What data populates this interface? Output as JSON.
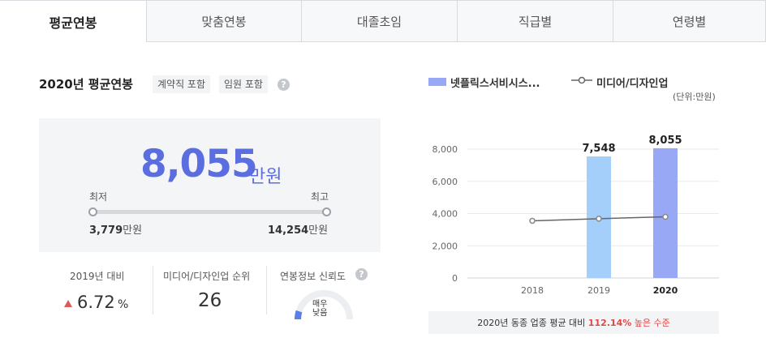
{
  "tabs": [
    {
      "label": "평균연봉",
      "active": true
    },
    {
      "label": "맞춤연봉",
      "active": false
    },
    {
      "label": "대졸초임",
      "active": false
    },
    {
      "label": "직급별",
      "active": false
    },
    {
      "label": "연령별",
      "active": false
    }
  ],
  "summary": {
    "title": "2020년 평균연봉",
    "chip_contract": "계약직 포함",
    "chip_exec": "임원 포함",
    "help": "?",
    "average": "8,055",
    "average_unit": "만원",
    "min_label": "최저",
    "max_label": "최고",
    "min_value": "3,779",
    "max_value": "14,254",
    "value_unit": "만원"
  },
  "stats": {
    "yoy_label": "2019년 대비",
    "yoy_value": "6.72",
    "yoy_unit": "%",
    "rank_label": "미디어/디자인업 순위",
    "rank_value": "26",
    "reliability_label": "연봉정보 신뢰도",
    "reliability_line1": "매우",
    "reliability_line2": "낮음",
    "reliability_level": 0.1
  },
  "colors": {
    "accent": "#5b6ee0",
    "bar_light": "#a5cffb",
    "bar_dark": "#98a8f4",
    "line": "#666666",
    "up": "#e05a5a"
  },
  "chart_data": {
    "type": "bar",
    "legend": [
      "넷플릭스서비시스...",
      "미디어/디자인업"
    ],
    "unit_label": "(단위:만원)",
    "categories": [
      "2018",
      "2019",
      "2020"
    ],
    "series": [
      {
        "name": "넷플릭스서비시스...",
        "values": [
          null,
          7548,
          8055
        ],
        "labels": [
          "",
          "7,548",
          "8,055"
        ]
      },
      {
        "name": "미디어/디자인업",
        "values": [
          3550,
          3680,
          3800
        ]
      }
    ],
    "yticks": [
      "0",
      "2,000",
      "4,000",
      "6,000",
      "8,000"
    ],
    "ylim": [
      0,
      8000
    ]
  },
  "note": {
    "prefix": "2020년 동종 업종 평균 대비",
    "percent": "112.14%",
    "suffix": "높은 수준"
  }
}
